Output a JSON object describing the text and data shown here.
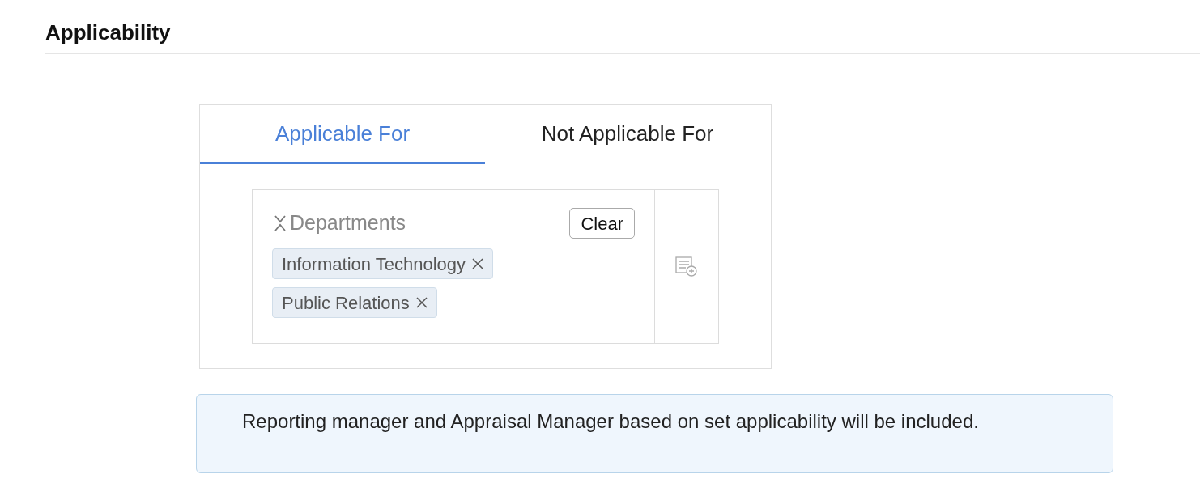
{
  "section": {
    "title": "Applicability"
  },
  "tabs": [
    {
      "label": "Applicable For",
      "selected": true
    },
    {
      "label": "Not Applicable For",
      "selected": false
    }
  ],
  "criteria": {
    "label": "Departments",
    "clear_button": "Clear",
    "tags": [
      {
        "label": "Information Technology"
      },
      {
        "label": "Public Relations"
      }
    ]
  },
  "info": {
    "message": "Reporting manager and Appraisal Manager based on set applicability will be included."
  }
}
